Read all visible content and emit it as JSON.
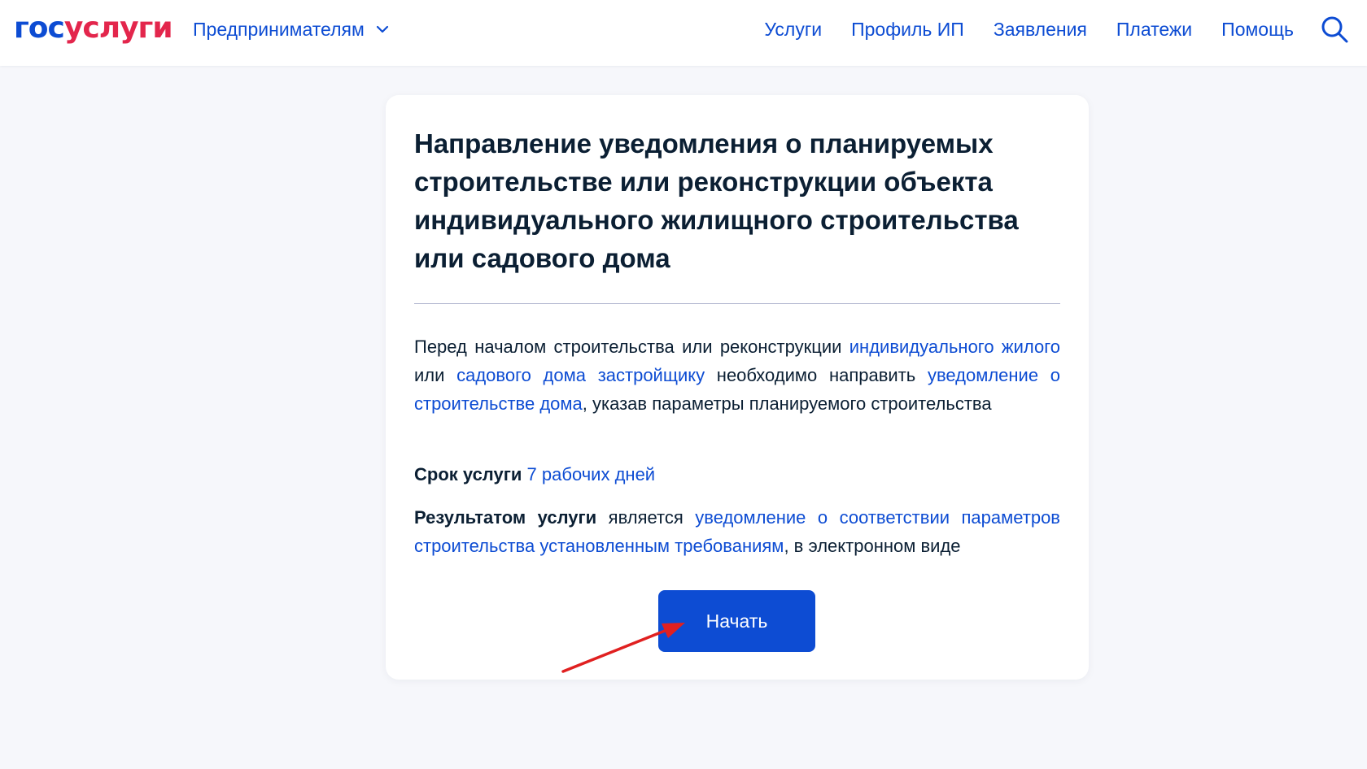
{
  "header": {
    "logo": {
      "part1": "гос",
      "part2": "услуги"
    },
    "audience_label": "Предпринимателям",
    "nav": [
      "Услуги",
      "Профиль ИП",
      "Заявления",
      "Платежи",
      "Помощь"
    ],
    "search_icon": "search-icon"
  },
  "card": {
    "title": "Направление уведомления о планируемых строительстве или реконструкции объекта индивидуального жилищного строительства или садового дома",
    "description": {
      "t1": "Перед началом строительства или реконструкции ",
      "link1": "индивидуального жилого",
      "t2": " или ",
      "link2": "садового дома",
      "t3": " ",
      "link3": "застройщику",
      "t4": " необходимо направить ",
      "link4": "уведомление о строительстве дома",
      "t5": ", указав параметры планируемого строительства"
    },
    "term": {
      "label": "Срок услуги",
      "value": "7 рабочих дней"
    },
    "result": {
      "label": "Результатом услуги",
      "t1": " является ",
      "link": "уведомление о соответствии параметров строительства установленным требованиям",
      "t2": ", в электронном виде"
    },
    "start_button": "Начать"
  },
  "colors": {
    "brand_blue": "#0d4cd3",
    "brand_red": "#e3264c",
    "text": "#0b1f33",
    "background": "#f6f7fb",
    "annotation_arrow": "#e02020"
  }
}
